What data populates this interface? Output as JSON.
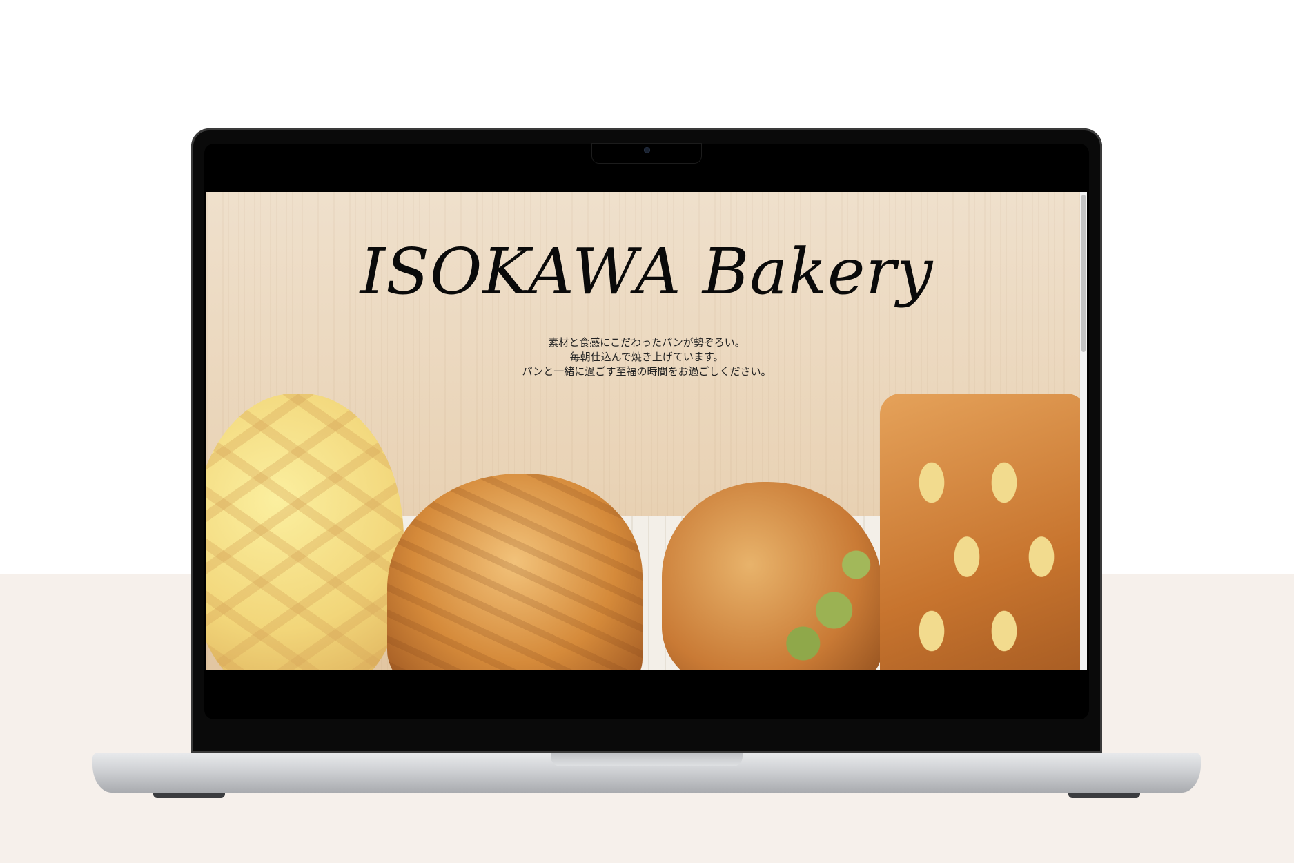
{
  "hero": {
    "title": "ISOKAWA Bakery",
    "tagline": [
      "素材と食感にこだわったパンが勢ぞろい。",
      "毎朝仕込んで焼き上げています。",
      "パンと一緒に過ごす至福の時間をお過ごしください。"
    ]
  },
  "colors": {
    "page_background": "#ffffff",
    "floor": "#f6f0eb",
    "hero_background": "#ecdcc6",
    "title_text": "#0a0a0a"
  }
}
